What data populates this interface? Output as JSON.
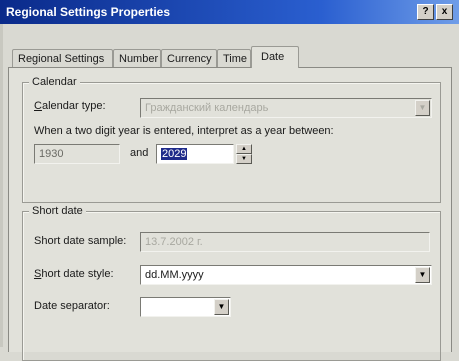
{
  "window": {
    "title": "Regional Settings Properties",
    "help_button": "?",
    "close_button": "x"
  },
  "tabs": [
    {
      "label": "Regional Settings",
      "active": false
    },
    {
      "label": "Number",
      "active": false
    },
    {
      "label": "Currency",
      "active": false
    },
    {
      "label": "Time",
      "active": false
    },
    {
      "label": "Date",
      "active": true
    }
  ],
  "calendar": {
    "group_label": "Calendar",
    "type_label": "Calendar type:",
    "type_value": "Гражданский календарь",
    "two_digit_text": "When a two digit year is entered, interpret as a year between:",
    "year_from": "1930",
    "and_label": "and",
    "year_to": "2029"
  },
  "short_date": {
    "group_label": "Short date",
    "sample_label": "Short date sample:",
    "sample_value": "13.7.2002 г.",
    "style_label": "Short date style:",
    "style_value": "dd.MM.yyyy",
    "separator_label": "Date separator:",
    "separator_value": ""
  },
  "icons": {
    "dropdown": "chevron-down-icon",
    "spin_up": "arrow-up-icon",
    "spin_down": "arrow-down-icon"
  },
  "colors": {
    "titlebar_start": "#0a2a8a",
    "titlebar_end": "#6f9de8",
    "selection": "#1e2a8a",
    "dialog_bg": "#e1e1da"
  }
}
